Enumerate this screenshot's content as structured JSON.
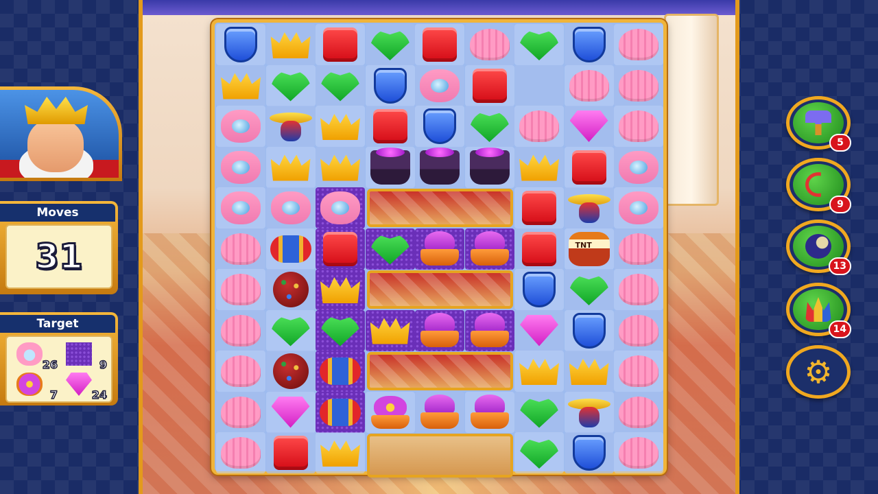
{
  "hud": {
    "moves_label": "Moves",
    "moves_value": "31",
    "target_label": "Target",
    "targets": [
      {
        "item": "pearl-shell",
        "count": "26"
      },
      {
        "item": "purple-grass",
        "count": "9"
      },
      {
        "item": "flower-pot",
        "count": "7"
      },
      {
        "item": "pink-gem",
        "count": "24"
      }
    ]
  },
  "boosters": [
    {
      "name": "royal-hammer",
      "count": "5"
    },
    {
      "name": "arrow",
      "count": "9"
    },
    {
      "name": "cannon",
      "count": "13"
    },
    {
      "name": "jester-hat",
      "count": "14"
    }
  ],
  "settings_icon": "gear-icon",
  "board": {
    "columns": 9,
    "rows": 11,
    "grid": [
      [
        "blue",
        "crown",
        "red",
        "green",
        "red",
        "shell",
        "green",
        "blue",
        "shell"
      ],
      [
        "crown",
        "green",
        "green",
        "blue",
        "pearl",
        "red",
        "empty",
        "shell",
        "shell"
      ],
      [
        "pearl",
        "prop",
        "crown",
        "red",
        "blue",
        "green",
        "shell",
        "gem",
        "shell"
      ],
      [
        "pearl",
        "crown",
        "crown",
        "hat",
        "hat",
        "hat",
        "crown",
        "red",
        "pearl"
      ],
      [
        "pearl",
        "pearl",
        "pearl",
        "hole",
        "hole",
        "hole",
        "red",
        "prop",
        "pearl"
      ],
      [
        "shell",
        "rocket",
        "red",
        "green",
        "pot",
        "pot",
        "red",
        "tnt",
        "shell"
      ],
      [
        "shell",
        "bomb",
        "crown",
        "hole",
        "hole",
        "hole",
        "blue",
        "green",
        "shell"
      ],
      [
        "shell",
        "green",
        "green",
        "crown",
        "pot",
        "pot",
        "gem",
        "blue",
        "shell"
      ],
      [
        "shell",
        "bomb",
        "rocket",
        "hole",
        "hole",
        "hole",
        "crown",
        "crown",
        "shell"
      ],
      [
        "shell",
        "gem",
        "rocket",
        "flower",
        "pot",
        "pot",
        "green",
        "prop",
        "shell"
      ],
      [
        "shell",
        "red",
        "crown",
        "hole",
        "hole",
        "hole",
        "green",
        "blue",
        "shell"
      ]
    ],
    "grass_cells": [
      [
        4,
        2
      ],
      [
        5,
        2
      ],
      [
        5,
        3
      ],
      [
        5,
        4
      ],
      [
        5,
        5
      ],
      [
        6,
        2
      ],
      [
        7,
        2
      ],
      [
        7,
        3
      ],
      [
        7,
        4
      ],
      [
        7,
        5
      ],
      [
        8,
        2
      ],
      [
        9,
        2
      ]
    ],
    "tnt_label": "TNT"
  }
}
